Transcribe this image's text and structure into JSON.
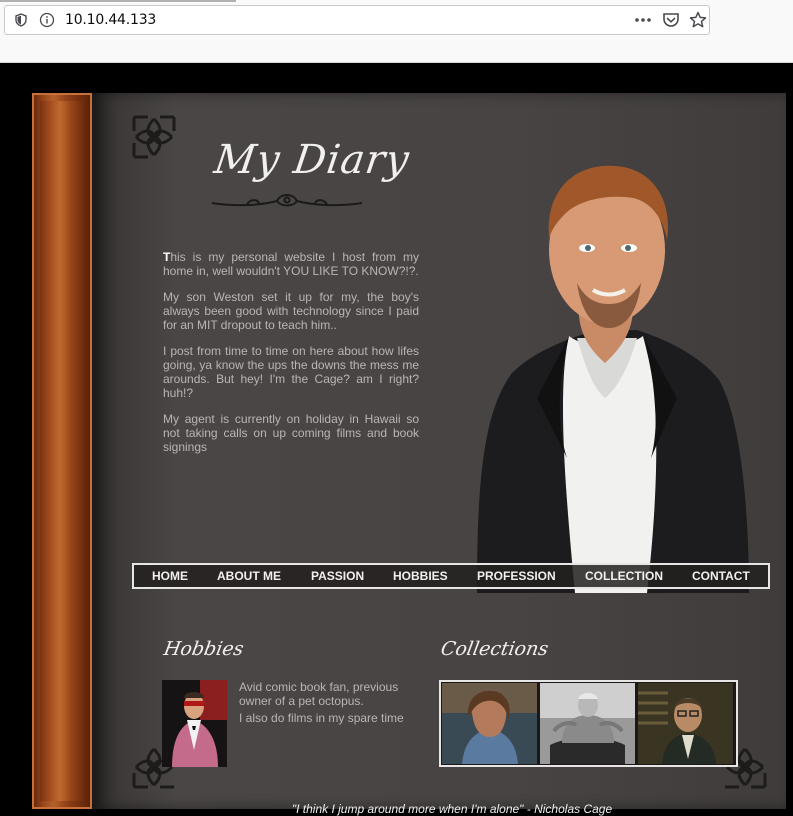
{
  "browser": {
    "url": "10.10.44.133",
    "icons": [
      "shield-icon",
      "info-icon",
      "more-actions-icon",
      "pocket-icon",
      "bookmark-star-icon"
    ]
  },
  "site": {
    "title": "My Diary",
    "intro": {
      "dropcap": "T",
      "p1_rest": "his is my personal website I host from my home in, well wouldn't YOU LIKE TO KNOW?!?.",
      "p2": "My son Weston set it up for my, the boy's always been good with technology since I paid for an MIT dropout to teach him..",
      "p3": "I post from time to time on here about how lifes going, ya know the ups the downs the mess me arounds. But hey! I'm the Cage? am I right? huh!?",
      "p4": "My agent is currently on holiday in Hawaii so not taking calls on up coming films and book signings"
    },
    "nav": [
      "HOME",
      "ABOUT ME",
      "PASSION",
      "HOBBIES",
      "PROFESSION",
      "COLLECTION",
      "CONTACT"
    ],
    "hobbies": {
      "heading": "Hobbies",
      "line1": "Avid comic book fan, previous owner of a pet octopus.",
      "line2": "I also do films in my spare time"
    },
    "collections": {
      "heading": "Collections"
    },
    "quote": "\"I think I jump around more when I'm alone\" - Nicholas Cage"
  },
  "colors": {
    "board": "#484444",
    "spine": "#a64f20",
    "text_muted": "#b9b6b4",
    "text_light": "#f2f0ee"
  }
}
